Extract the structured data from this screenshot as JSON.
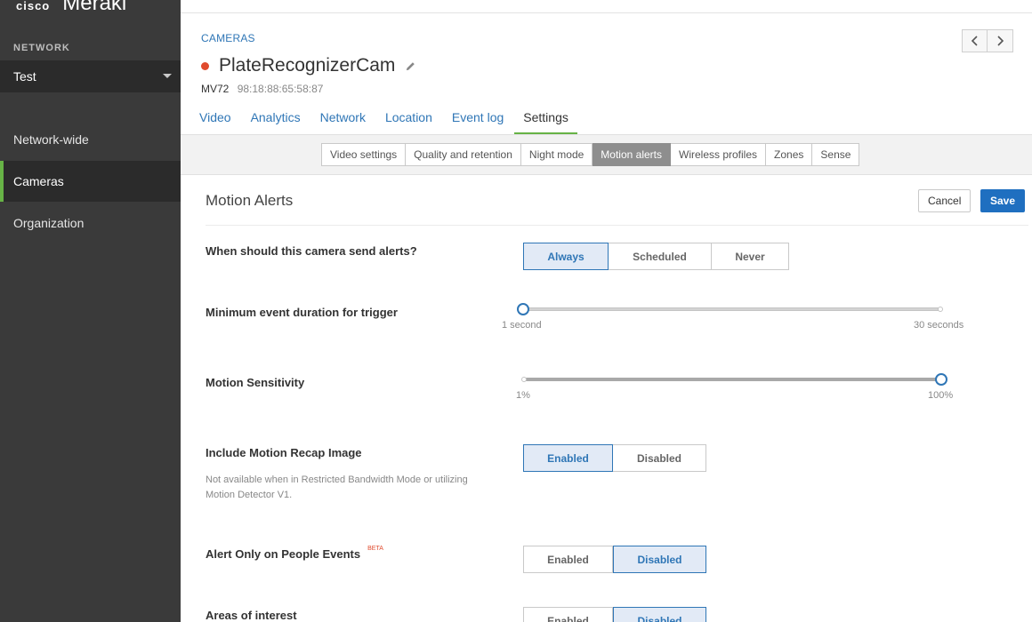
{
  "brand": {
    "cisco": "cisco",
    "product": "Meraki"
  },
  "sidebar": {
    "network_label": "NETWORK",
    "network_selected": "Test",
    "items": [
      {
        "label": "Network-wide"
      },
      {
        "label": "Cameras"
      },
      {
        "label": "Organization"
      }
    ]
  },
  "header": {
    "breadcrumb": "CAMERAS",
    "device_name": "PlateRecognizerCam",
    "model": "MV72",
    "mac": "98:18:88:65:58:87"
  },
  "tabs": [
    "Video",
    "Analytics",
    "Network",
    "Location",
    "Event log",
    "Settings"
  ],
  "subtabs": [
    "Video settings",
    "Quality and retention",
    "Night mode",
    "Motion alerts",
    "Wireless profiles",
    "Zones",
    "Sense"
  ],
  "section": {
    "title": "Motion Alerts",
    "cancel_label": "Cancel",
    "save_label": "Save"
  },
  "settings": {
    "send_alerts": {
      "label": "When should this camera send alerts?",
      "options": [
        "Always",
        "Scheduled",
        "Never"
      ],
      "selected": "Always"
    },
    "min_duration": {
      "label": "Minimum event duration for trigger",
      "min_label": "1 second",
      "max_label": "30 seconds",
      "value_fraction": 0.0
    },
    "sensitivity": {
      "label": "Motion Sensitivity",
      "min_label": "1%",
      "max_label": "100%",
      "value_fraction": 1.0
    },
    "recap_image": {
      "label": "Include Motion Recap Image",
      "note": "Not available when in Restricted Bandwidth Mode or utilizing Motion Detector V1.",
      "options": [
        "Enabled",
        "Disabled"
      ],
      "selected": "Enabled"
    },
    "people_events": {
      "label": "Alert Only on People Events",
      "badge": "BETA",
      "options": [
        "Enabled",
        "Disabled"
      ],
      "selected": "Disabled"
    },
    "areas_of_interest": {
      "label": "Areas of interest",
      "options": [
        "Enabled",
        "Disabled"
      ],
      "selected": "Disabled"
    }
  },
  "colors": {
    "accent_green": "#67b346",
    "link_blue": "#2f76b6",
    "save_blue": "#1f6fc0",
    "status_red": "#e04b2e",
    "sidebar_bg": "#3a3a3a"
  }
}
